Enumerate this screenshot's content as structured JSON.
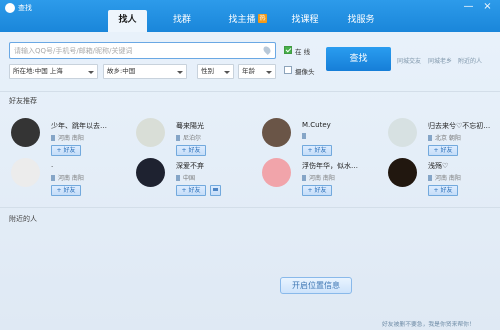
{
  "window": {
    "title": "查找",
    "minimize": "—",
    "close": "×"
  },
  "tabs": [
    {
      "label": "找人",
      "active": true
    },
    {
      "label": "找群",
      "active": false
    },
    {
      "label": "找主播",
      "badge": "热",
      "active": false
    },
    {
      "label": "找课程",
      "active": false
    },
    {
      "label": "找服务",
      "active": false
    }
  ],
  "search": {
    "placeholder": "请输入QQ号/手机号/邮箱/昵称/关键词",
    "value": "",
    "location": "所在地:中国 上海",
    "hometown": "故乡:中国",
    "gender": "性别",
    "age": "年龄",
    "online_label": "在 线",
    "camera_label": "摄像头",
    "online_checked": true,
    "camera_checked": false,
    "button": "查找",
    "quick_links": [
      "同城交友",
      "同城老乡",
      "附近的人"
    ]
  },
  "recommend": {
    "title": "好友推荐",
    "add_label": "+ 好友",
    "friends": [
      {
        "name": "少年、跳年以去…",
        "location": "河南 南阳",
        "avatar": "#343434"
      },
      {
        "name": "蓦来陽光",
        "location": "尼泊尔",
        "avatar": "#d9ded7"
      },
      {
        "name": "M.Cutey",
        "location": "",
        "avatar": "#6a5547"
      },
      {
        "name": "归去来兮♡不忘初…",
        "location": "北京 朝阳",
        "avatar": "#d7e1e2"
      },
      {
        "name": ".",
        "location": "河南 南阳",
        "avatar": "#ececec"
      },
      {
        "name": "深爱不弃",
        "location": "中国",
        "avatar": "#1e2230",
        "message": true
      },
      {
        "name": "浮伤年华，似水…",
        "location": "河南 南阳",
        "avatar": "#f1a4aa"
      },
      {
        "name": "浅殇♡",
        "location": "河南 南阳",
        "avatar": "#21170f"
      }
    ]
  },
  "nearby": {
    "title": "附近的人",
    "button": "开启位置信息"
  },
  "footer": "好友被删不要急，我是你贤来帮你！"
}
